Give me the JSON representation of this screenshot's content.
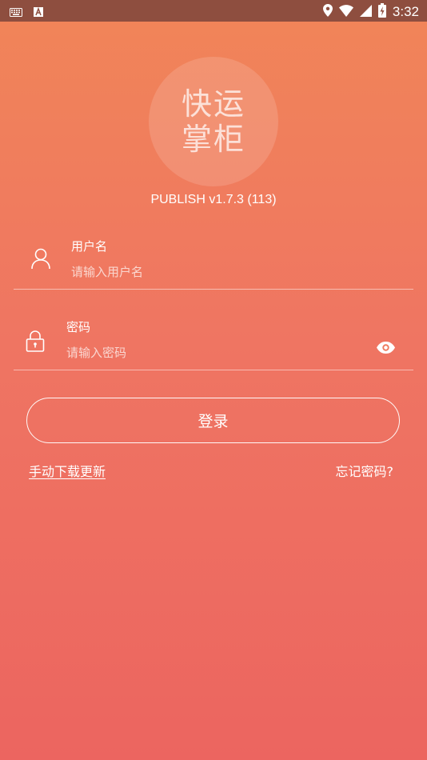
{
  "status_bar": {
    "time": "3:32",
    "left_icons": [
      "keyboard-icon",
      "font-a-icon"
    ],
    "right_icons": [
      "location-icon",
      "wifi-icon",
      "signal-icon",
      "battery-charging-icon"
    ]
  },
  "logo": {
    "line1": "快运",
    "line2": "掌柜"
  },
  "version": "PUBLISH v1.7.3 (113)",
  "username": {
    "label": "用户名",
    "placeholder": "请输入用户名",
    "value": ""
  },
  "password": {
    "label": "密码",
    "placeholder": "请输入密码",
    "value": ""
  },
  "login_button": "登录",
  "links": {
    "manual_update": "手动下载更新",
    "forgot_password": "忘记密码?"
  },
  "colors": {
    "status_bar": "#8e4e3f",
    "gradient_top": "#f18558",
    "gradient_bottom": "#ec6560",
    "text": "#ffffff"
  }
}
